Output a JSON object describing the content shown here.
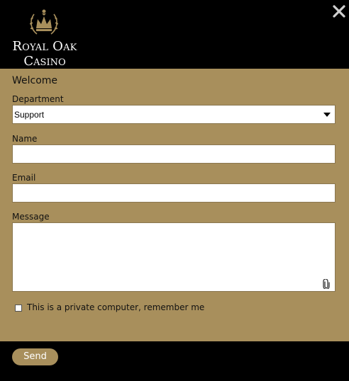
{
  "brand": {
    "line1": "Royal Oak",
    "line2": "Casino"
  },
  "icons": {
    "close": "close-icon",
    "attach": "paperclip-icon",
    "select": "chevron-down-icon",
    "emblem": "crown-laurel-icon"
  },
  "colors": {
    "panel": "#a88f5c",
    "background": "#000000",
    "button": "#a88f5c"
  },
  "form": {
    "title": "Welcome",
    "department": {
      "label": "Department",
      "value": "Support"
    },
    "name": {
      "label": "Name",
      "value": ""
    },
    "email": {
      "label": "Email",
      "value": ""
    },
    "message": {
      "label": "Message",
      "value": ""
    },
    "remember": {
      "label": "This is a private computer, remember me",
      "checked": false
    }
  },
  "footer": {
    "send_label": "Send"
  }
}
